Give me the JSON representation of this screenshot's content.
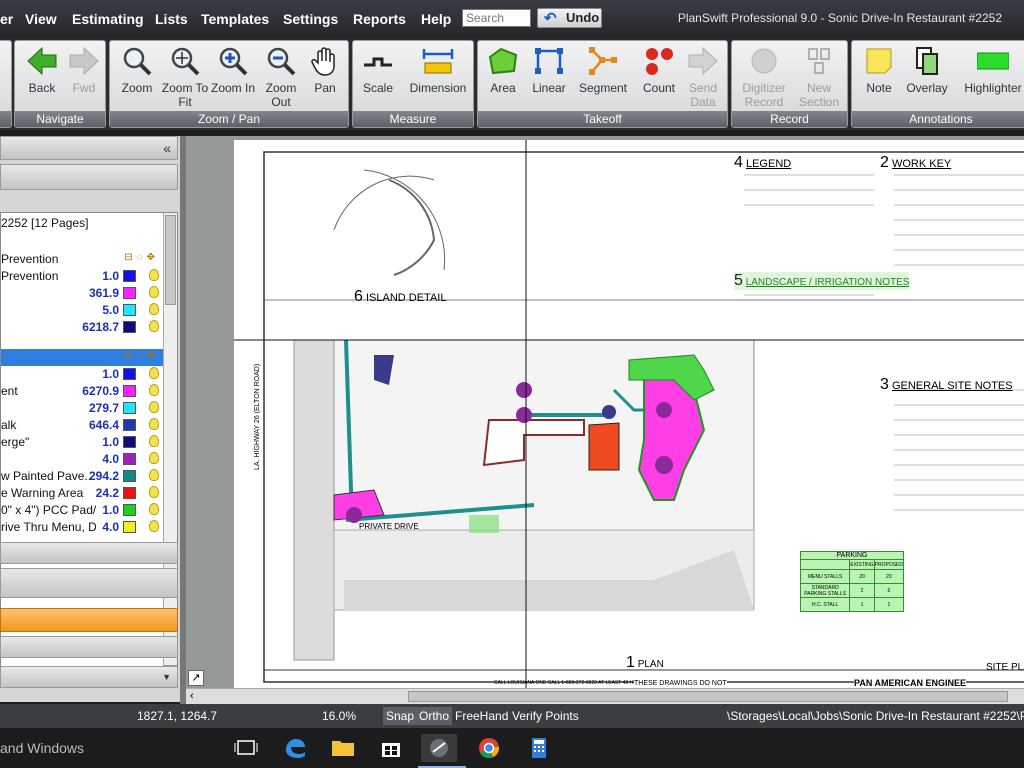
{
  "menu": {
    "items": [
      "er",
      "View",
      "Estimating",
      "Lists",
      "Templates",
      "Settings",
      "Reports",
      "Help"
    ],
    "search_placeholder": "Search",
    "undo": "Undo"
  },
  "title": "PlanSwift Professional 9.0 - Sonic Drive-In Restaurant #2252",
  "ribbon": {
    "groups": [
      "Navigate",
      "Zoom / Pan",
      "Measure",
      "Takeoff",
      "Record",
      "Annotations"
    ],
    "tools": {
      "back": "Back",
      "fwd": "Fwd",
      "zoom": "Zoom",
      "zoom_to_fit": "Zoom To Fit",
      "zoom_in": "Zoom In",
      "zoom_out": "Zoom Out",
      "pan": "Pan",
      "scale": "Scale",
      "dimension": "Dimension",
      "area": "Area",
      "linear": "Linear",
      "segment": "Segment",
      "count": "Count",
      "send_data": "Send Data",
      "digitizer_record": "Digitizer Record",
      "new_section": "New Section",
      "note": "Note",
      "overlay": "Overlay",
      "highlighter": "Highlighter"
    }
  },
  "panel": {
    "collapse": "«",
    "job": "2252 [12 Pages]",
    "rows": [
      {
        "label": "Prevention",
        "value": "",
        "color": "",
        "header": true
      },
      {
        "label": "Prevention",
        "value": "1.0",
        "color": "#1010f0"
      },
      {
        "label": "",
        "value": "361.9",
        "color": "#ff20ff"
      },
      {
        "label": "",
        "value": "5.0",
        "color": "#20e6ff"
      },
      {
        "label": "",
        "value": "6218.7",
        "color": "#0e0e7a"
      },
      {
        "label": "",
        "value": "",
        "color": "",
        "header": true,
        "selected": true
      },
      {
        "label": "",
        "value": "1.0",
        "color": "#1010f0"
      },
      {
        "label": "ent",
        "value": "6270.9",
        "color": "#ff20ff"
      },
      {
        "label": "",
        "value": "279.7",
        "color": "#20e6ff"
      },
      {
        "label": "alk",
        "value": "646.4",
        "color": "#1a3cb0"
      },
      {
        "label": "erge\"",
        "value": "1.0",
        "color": "#0e0e7a"
      },
      {
        "label": "",
        "value": "4.0",
        "color": "#a020c0"
      },
      {
        "label": "w Painted Pave...",
        "value": "294.2",
        "color": "#0e8a8a"
      },
      {
        "label": "e Warning Area",
        "value": "24.2",
        "color": "#f01010"
      },
      {
        "label": "0\" x 4\") PCC Pad/...",
        "value": "1.0",
        "color": "#20d020"
      },
      {
        "label": "rive Thru Menu, Dri...",
        "value": "4.0",
        "color": "#f0f020"
      }
    ]
  },
  "drawing": {
    "legend": "LEGEND",
    "legend_num": "4",
    "work_key": "WORK KEY",
    "work_key_num": "2",
    "landscape": "LANDSCAPE / IRRIGATION NOTES",
    "landscape_num": "5",
    "island": "ISLAND DETAIL",
    "island_num": "6",
    "general": "GENERAL SITE NOTES",
    "general_num": "3",
    "private_drive": "PRIVATE DRIVE",
    "road": "LA. HIGHWAY 26 (ELTON ROAD)",
    "plan": "PLAN",
    "plan_num": "1",
    "site_plan": "SITE PLA",
    "parking": "PARKING",
    "parking_hdr": [
      "",
      "EXISTING",
      "PROPOSED"
    ],
    "parking_rows": [
      [
        "MENU STALLS",
        "20",
        "20"
      ],
      [
        "STANDARD PARKING STALLS",
        "2",
        "6"
      ],
      [
        "H.C. STALL",
        "1",
        "1"
      ]
    ],
    "engineer": "PAN AMERICAN ENGINEE",
    "drawing_note": "THESE DRAWINGS DO NOT",
    "call": "CALL LOUISIANA ONE CALL 1-800-272-3020 AT LEAST 48 HOURS BEFORE YOU DIG"
  },
  "status": {
    "coords": "1827.1, 1264.7",
    "zoom": "16.0%",
    "snap": "Snap",
    "ortho": "Ortho",
    "freehand": "FreeHand",
    "verify": "Verify Points",
    "path": "\\Storages\\Local\\Jobs\\Sonic Drive-In Restaurant #2252\\Pages"
  },
  "taskbar": {
    "text": "and Windows"
  }
}
